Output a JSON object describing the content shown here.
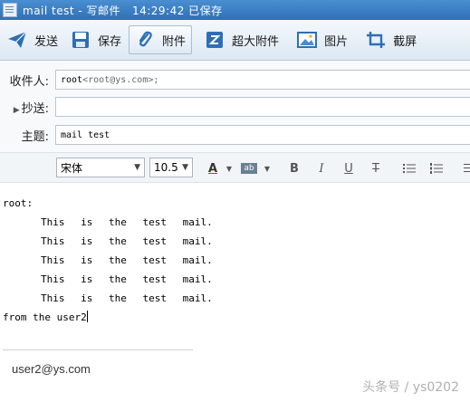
{
  "window": {
    "title": "mail test - 写邮件   14:29:42 已保存"
  },
  "toolbar": {
    "items": [
      {
        "label": "发送",
        "icon": "send-icon"
      },
      {
        "label": "保存",
        "icon": "save-icon"
      },
      {
        "label": "附件",
        "icon": "attachment-icon",
        "active": true
      },
      {
        "label": "超大附件",
        "icon": "large-attachment-icon"
      },
      {
        "label": "图片",
        "icon": "image-icon"
      },
      {
        "label": "截屏",
        "icon": "screenshot-icon"
      }
    ]
  },
  "header": {
    "to_label": "收件人:",
    "to_name": "root",
    "to_address": "<root@ys.com>;",
    "cc_label": "抄送:",
    "cc_value": "",
    "subject_label": "主题:",
    "subject_value": "mail test"
  },
  "format": {
    "font_family": "宋体",
    "font_size": "10.5",
    "buttons": [
      "A",
      "ab",
      "B",
      "I",
      "U",
      "T"
    ]
  },
  "body": {
    "greeting": "root:",
    "lines": [
      "This is the test mail.",
      "This is the test mail.",
      "This is the test mail.",
      "This is the test mail.",
      "This is the test mail."
    ],
    "closing": "from the user2",
    "signature": "user2@ys.com"
  },
  "watermark": "头条号 / ys0202",
  "colors": {
    "titlebar": "#2f6fb6",
    "toolbar_icon": "#2d6fb5"
  }
}
